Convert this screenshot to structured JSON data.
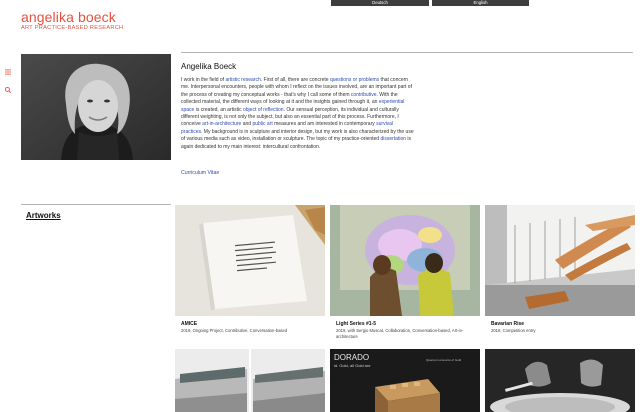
{
  "brand": {
    "name": "angelika boeck",
    "tagline": "ART PRACTICE-BASED RESEARCH"
  },
  "languages": [
    "Deutsch",
    "English"
  ],
  "sidebar": {
    "menu_icon": "menu-icon",
    "search_icon": "search-icon"
  },
  "bio": {
    "name": "Angelika Boeck",
    "segments": [
      {
        "t": "I work in the field of "
      },
      {
        "t": "artistic research",
        "link": true
      },
      {
        "t": ". First of all, there are concrete "
      },
      {
        "t": "questions or problems",
        "link": true
      },
      {
        "t": " that concern me. Interpersonal encounters, people with whom I reflect on the issues involved, are an important part of the process of creating my conceptual works - that's why I call some of them "
      },
      {
        "t": "contributive",
        "link": true
      },
      {
        "t": ". With the collected material, the different ways of looking at it and the insights gained through it, an "
      },
      {
        "t": "experiential space",
        "link": true
      },
      {
        "t": " is created, an artistic "
      },
      {
        "t": "object of reflection",
        "link": true
      },
      {
        "t": ". Our sensual perception, its individual and culturally different weighting, is not only the subject, but also an essential part of this process. Furthermore, I conceive "
      },
      {
        "t": "art-in-architecture",
        "link": true
      },
      {
        "t": " and "
      },
      {
        "t": "public art",
        "link": true
      },
      {
        "t": " measures and am interested in contemporary "
      },
      {
        "t": "survival practices",
        "link": true
      },
      {
        "t": ". My background is in sculpture and interior design, but my work is also characterized by the use of various media such as video, installation or sculpture. The topic of my practice-oriented "
      },
      {
        "t": "dissertation",
        "link": true
      },
      {
        "t": " is again dedicated to my main interest: intercultural confrontation."
      }
    ],
    "cv_link": "Curriculum Vitae"
  },
  "artworks": {
    "heading": "Artworks",
    "items": [
      {
        "title": "AMICE",
        "desc": "2019, Ongoing Project, Contributive, Conversation-based"
      },
      {
        "title": "Light Series #1-5",
        "desc": "2019, with Sergio Muscat, Collaboration, Conversation-based, Art-in-architecture"
      },
      {
        "title": "Bavarian Rise",
        "desc": "2018, Competition entry"
      }
    ],
    "row2_sign_text": "DORADO",
    "row2_sign_sub": "ld. Gold, all Gold are",
    "row2_sign_small": "Quantum amounts of Gold"
  },
  "colors": {
    "accent": "#e6513f",
    "link": "#2f4ab0",
    "lang_bar": "#3d3d3d"
  }
}
